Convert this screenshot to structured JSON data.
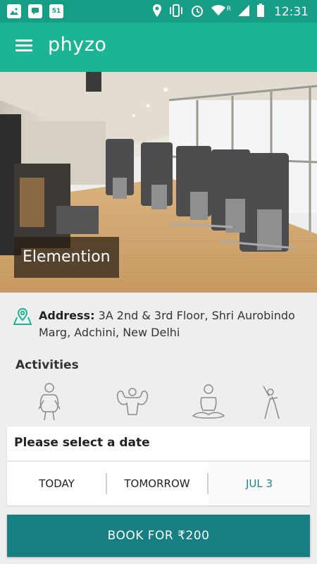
{
  "status_bar": {
    "time": "12:31",
    "left_icons": [
      "image-icon",
      "chat-icon",
      "calendar-icon"
    ],
    "calendar_day": "51",
    "signal_letter": "R",
    "right_icons": [
      "location-icon",
      "vibrate-icon",
      "alarm-icon",
      "wifi-icon",
      "cell-signal-icon",
      "battery-icon"
    ]
  },
  "app_bar": {
    "logo": "phyzo"
  },
  "hero": {
    "gym_name": "Elemention"
  },
  "address": {
    "label": "Address:",
    "value": "3A 2nd & 3rd Floor, Shri Aurobindo Marg, Adchini, New Delhi"
  },
  "activities": {
    "title": "Activities",
    "icons": [
      "weight-loss-icon",
      "muscle-icon",
      "meditation-icon",
      "stretching-icon"
    ]
  },
  "date_selector": {
    "title": "Please select a date",
    "options": [
      "TODAY",
      "TOMORROW",
      "JUL 3"
    ],
    "selected": "JUL 3"
  },
  "book_button": {
    "label": "BOOK FOR ₹200"
  },
  "colors": {
    "status_bar": "#169f86",
    "app_bar": "#1bb495",
    "book_button": "#177f82",
    "selected_date": "#1a8289"
  }
}
